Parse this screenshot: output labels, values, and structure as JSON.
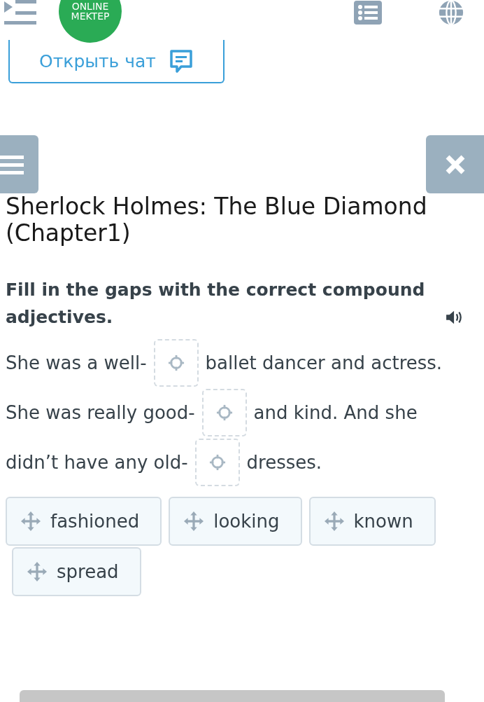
{
  "header": {
    "logo": [
      "ONLINE",
      "MEKTEP"
    ]
  },
  "chat_button": {
    "label": "Открыть чат"
  },
  "title": "Sherlock Holmes: The Blue Diamond (Chapter1)",
  "instruction": "Fill in the gaps with the correct compound adjectives.",
  "sentence_lines": [
    [
      {
        "kind": "text",
        "text": "She was a well-"
      },
      {
        "kind": "gap"
      },
      {
        "kind": "text",
        "text": "ballet dancer and actress."
      }
    ],
    [
      {
        "kind": "text",
        "text": "She was really good-"
      },
      {
        "kind": "gap"
      },
      {
        "kind": "text",
        "text": "and kind. And she"
      }
    ],
    [
      {
        "kind": "text",
        "text": "didn’t have any old-"
      },
      {
        "kind": "gap"
      },
      {
        "kind": "text",
        "text": "dresses."
      }
    ]
  ],
  "word_options": [
    "fashioned",
    "looking",
    "known",
    "spread"
  ]
}
